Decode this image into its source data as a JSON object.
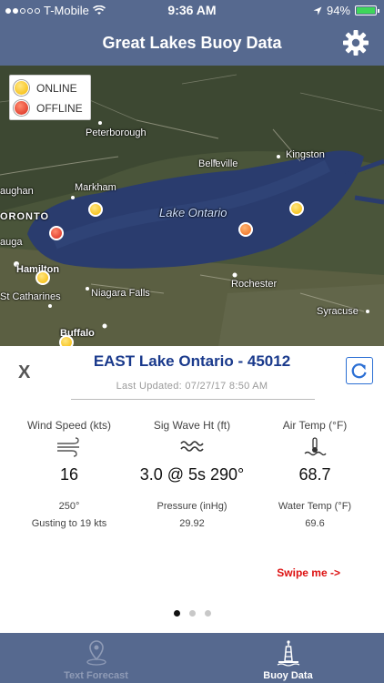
{
  "status": {
    "carrier": "T-Mobile",
    "time": "9:36 AM",
    "battery": "94%"
  },
  "nav": {
    "title": "Great Lakes Buoy Data"
  },
  "legend": {
    "online": "ONLINE",
    "offline": "OFFLINE"
  },
  "map": {
    "labels": {
      "peterborough": "Peterborough",
      "belleville": "Belleville",
      "kingston": "Kingston",
      "markham": "Markham",
      "aughan": "aughan",
      "oronto": "ORONTO",
      "auga": "auga",
      "hamilton": "Hamilton",
      "st_catharines": "St Catharines",
      "niagara_falls": "Niagara Falls",
      "rochester": "Rochester",
      "syracuse": "Syracuse",
      "buffalo": "Buffalo",
      "lake": "Lake Ontario"
    }
  },
  "panel": {
    "close": "X",
    "title": "EAST Lake Ontario - 45012",
    "last_updated": "Last Updated: 07/27/17 8:50 AM",
    "wind": {
      "label": "Wind Speed (kts)",
      "value": "16",
      "direction": "250°",
      "gust": "Gusting to 19 kts"
    },
    "wave": {
      "label": "Sig Wave Ht (ft)",
      "value": "3.0 @ 5s 290°",
      "pressure_label": "Pressure (inHg)",
      "pressure": "29.92"
    },
    "air": {
      "label": "Air Temp (°F)",
      "value": "68.7",
      "water_label": "Water Temp (°F)",
      "water": "69.6"
    },
    "swipe": "Swipe me ->"
  },
  "tabs": [
    {
      "label": "Text Forecast",
      "icon": "location-pin-icon",
      "color": "#8f9bb6"
    },
    {
      "label": "Buoy Data",
      "icon": "buoy-icon",
      "color": "#ffffff"
    }
  ],
  "colors": {
    "bar": "#56698f",
    "title": "#1a3a8c",
    "swipe": "#dd1111"
  }
}
